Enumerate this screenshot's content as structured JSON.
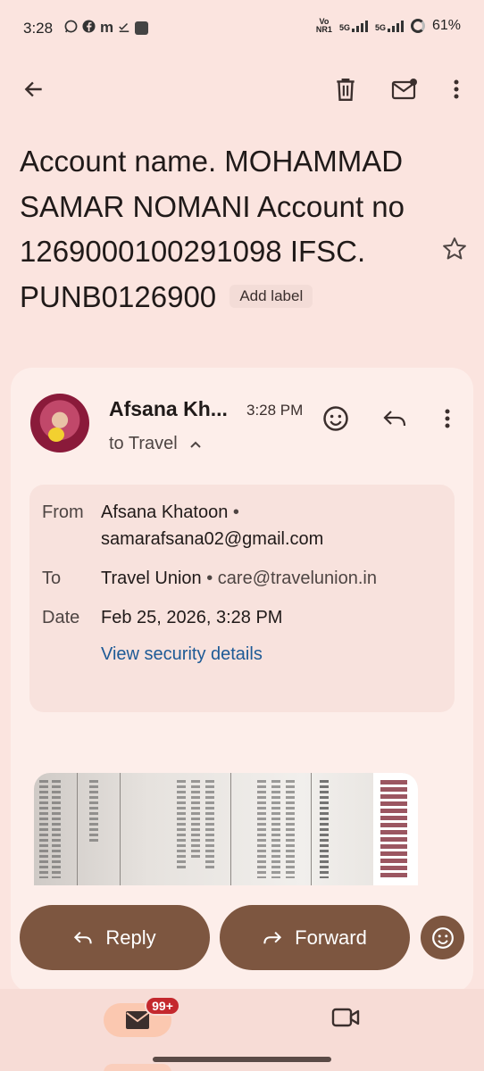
{
  "status_bar": {
    "time": "3:28",
    "notif_m": "m",
    "network_a": "Vo\nNR1",
    "network_b": "5G",
    "network_c": "5G",
    "battery": "61%"
  },
  "subject": {
    "text": "Account name. MOHAMMAD SAMAR NOMANI  Account no 1269000100291098 IFSC. PUNB0126900",
    "add_label": "Add label"
  },
  "message": {
    "sender_name": "Afsana Kh...",
    "time": "3:28 PM",
    "to_summary": "to Travel",
    "details": {
      "from_label": "From",
      "from_name": "Afsana Khatoon",
      "from_email": "samarafsana02@gmail.com",
      "to_label": "To",
      "to_name": "Travel Union",
      "to_email": "care@travelunion.in",
      "date_label": "Date",
      "date_value": "Feb 25, 2026, 3:28 PM",
      "security_link": "View security details"
    }
  },
  "actions": {
    "reply": "Reply",
    "forward": "Forward"
  },
  "bottom_nav": {
    "mail_badge": "99+"
  },
  "colors": {
    "background": "#fbe4df",
    "button": "#7d5640",
    "link": "#1d5a96",
    "badge": "#c4282d"
  }
}
